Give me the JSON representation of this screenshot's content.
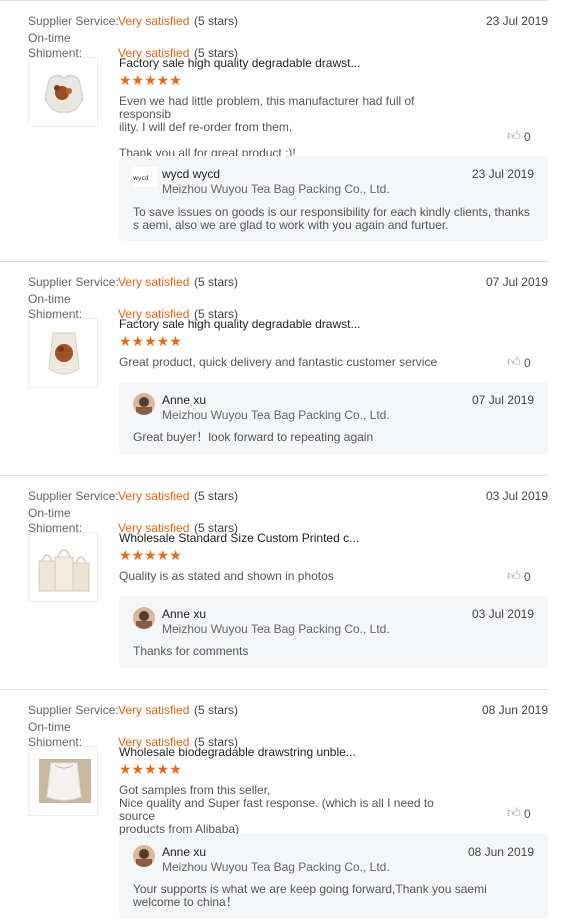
{
  "labels": {
    "supplier_service": "Supplier Service:",
    "on_time": "On-time",
    "shipment": "Shipment:"
  },
  "reviews": [
    {
      "supplier_rating": "Very satisfied",
      "supplier_stars": "(5 stars)",
      "date": "23 Jul 2019",
      "shipment_rating": "Very satisfied",
      "shipment_stars": "(5 stars)",
      "product_title": "Factory sale high quality degradable drawst...",
      "stars": "★★★★★",
      "body": "Even we had little problem, this manufacturer had full of responsib\nility. I will def re-order from them.\n\nThank you all for great product :)!",
      "likes": "0",
      "reply": {
        "name": "wycd wycd",
        "company": "Meizhou Wuyou Tea Bag Packing Co., Ltd.",
        "date": "23 Jul 2019",
        "text": "To save issues on goods is our responsibility for each kindly clients, thanks s aemi, also we are glad to work with you again and furtuer."
      }
    },
    {
      "supplier_rating": "Very satisfied",
      "supplier_stars": "(5 stars)",
      "date": "07 Jul 2019",
      "shipment_rating": "Very satisfied",
      "shipment_stars": "(5 stars)",
      "product_title": "Factory sale high quality degradable drawst...",
      "stars": "★★★★★",
      "body": "Great product, quick delivery and fantastic customer service",
      "likes": "0",
      "reply": {
        "name": "Anne xu",
        "company": "Meizhou Wuyou Tea Bag Packing Co., Ltd.",
        "date": "07 Jul 2019",
        "text": "Great buyer！look forward to repeating again"
      }
    },
    {
      "supplier_rating": "Very satisfied",
      "supplier_stars": "(5 stars)",
      "date": "03 Jul 2019",
      "shipment_rating": "Very satisfied",
      "shipment_stars": "(5 stars)",
      "product_title": "Wholesale Standard Size Custom Printed c...",
      "stars": "★★★★★",
      "body": "Quality is as stated and shown in photos",
      "likes": "0",
      "reply": {
        "name": "Anne xu",
        "company": "Meizhou Wuyou Tea Bag Packing Co., Ltd.",
        "date": "03 Jul 2019",
        "text": "Thanks for comments"
      }
    },
    {
      "supplier_rating": "Very satisfied",
      "supplier_stars": "(5 stars)",
      "date": "08 Jun 2019",
      "shipment_rating": "Very satisfied",
      "shipment_stars": "(5 stars)",
      "product_title": "Wholesale biodegradable drawstring unble...",
      "stars": "★★★★★",
      "body": "Got samples from this seller,\nNice quality and Super fast response. (which is all I need to source\nproducts from Alibaba)",
      "likes": "0",
      "reply": {
        "name": "Anne xu",
        "company": "Meizhou Wuyou Tea Bag Packing Co., Ltd.",
        "date": "08 Jun 2019",
        "text": "Your supports is what we are keep going forward,Thank you saemi welcome to china！"
      }
    }
  ],
  "colors": {
    "accent": "#e8620d",
    "reply_bg": "#f5f6f8"
  },
  "icons": {
    "like": "thumbs-up-icon"
  }
}
